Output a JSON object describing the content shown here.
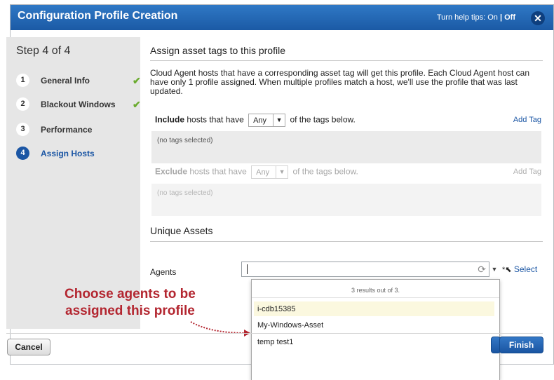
{
  "dialog": {
    "title": "Configuration Profile Creation",
    "help_tips": {
      "label": "Turn help tips:",
      "on": "On",
      "separator": "|",
      "off": "Off"
    },
    "close_icon": "close-icon"
  },
  "sidebar": {
    "step_title": "Step 4 of 4",
    "steps": [
      {
        "num": "1",
        "label": "General Info",
        "complete": true
      },
      {
        "num": "2",
        "label": "Blackout Windows",
        "complete": true
      },
      {
        "num": "3",
        "label": "Performance",
        "complete": false
      },
      {
        "num": "4",
        "label": "Assign Hosts",
        "complete": false,
        "active": true
      }
    ],
    "check_glyph": "✔"
  },
  "main": {
    "heading": "Assign asset tags to this profile",
    "description": "Cloud Agent hosts that have a corresponding asset tag will get this profile. Each Cloud Agent host can have only 1 profile assigned. When multiple profiles match a host, we'll use the profile that was last updated.",
    "include": {
      "keyword": "Include",
      "text_before": "hosts that have",
      "select_value": "Any",
      "text_after": "of the tags below.",
      "add_tag": "Add Tag",
      "empty": "(no tags selected)"
    },
    "exclude": {
      "keyword": "Exclude",
      "text_before": "hosts that have",
      "select_value": "Any",
      "text_after": "of the tags below.",
      "add_tag": "Add Tag",
      "empty": "(no tags selected)"
    },
    "unique_assets_heading": "Unique Assets",
    "agents": {
      "label": "Agents",
      "input_value": "",
      "select_label": "Select",
      "results_count": "3 results out of 3.",
      "results": [
        "i-cdb15385",
        "My-Windows-Asset",
        "temp test1"
      ]
    }
  },
  "annotation": {
    "line1": "Choose agents to be",
    "line2": "assigned this profile"
  },
  "footer": {
    "cancel": "Cancel",
    "finish": "Finish"
  },
  "colors": {
    "title_bar": "#1b5aa5",
    "accent": "#1b56a4",
    "annotation": "#b32630",
    "check": "#6aab2e",
    "highlight_row": "#fbf8df"
  }
}
